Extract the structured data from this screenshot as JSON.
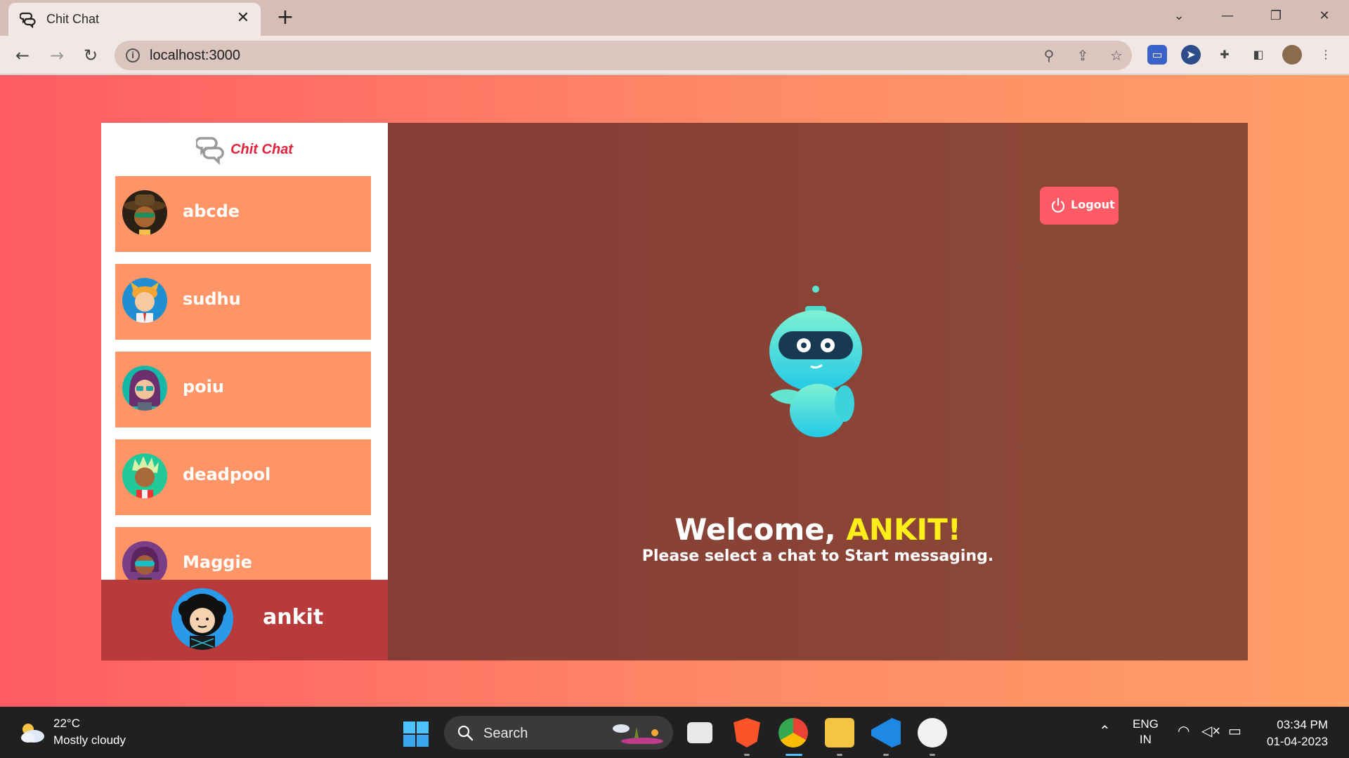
{
  "browser": {
    "tab_title": "Chit Chat",
    "url": "localhost:3000"
  },
  "app": {
    "brand": "Chit Chat",
    "contacts": [
      {
        "name": "abcde",
        "avatar": "avatar-cowboy-hat-sunglasses"
      },
      {
        "name": "sudhu",
        "avatar": "avatar-blonde-horns"
      },
      {
        "name": "poiu",
        "avatar": "avatar-purple-hair-glasses"
      },
      {
        "name": "deadpool",
        "avatar": "avatar-green-hair"
      },
      {
        "name": "Maggie",
        "avatar": "avatar-purple-visor"
      }
    ],
    "current_user": {
      "name": "ankit",
      "avatar": "avatar-curly-hair"
    },
    "logout_label": "Logout",
    "welcome_prefix": "Welcome, ",
    "welcome_name": "ANKIT!",
    "welcome_sub": "Please select a chat to Start messaging.",
    "colors": {
      "contact_bg": "#ff9566",
      "current_user_bg": "#b83a3a",
      "main_bg": "#873d36",
      "logout_bg": "#ff5b67",
      "brand": "#e0233a",
      "username_highlight": "#ffee1a"
    }
  },
  "taskbar": {
    "weather_temp": "22°C",
    "weather_desc": "Mostly cloudy",
    "search_label": "Search",
    "lang_top": "ENG",
    "lang_bottom": "IN",
    "time": "03:34 PM",
    "date": "01-04-2023"
  }
}
